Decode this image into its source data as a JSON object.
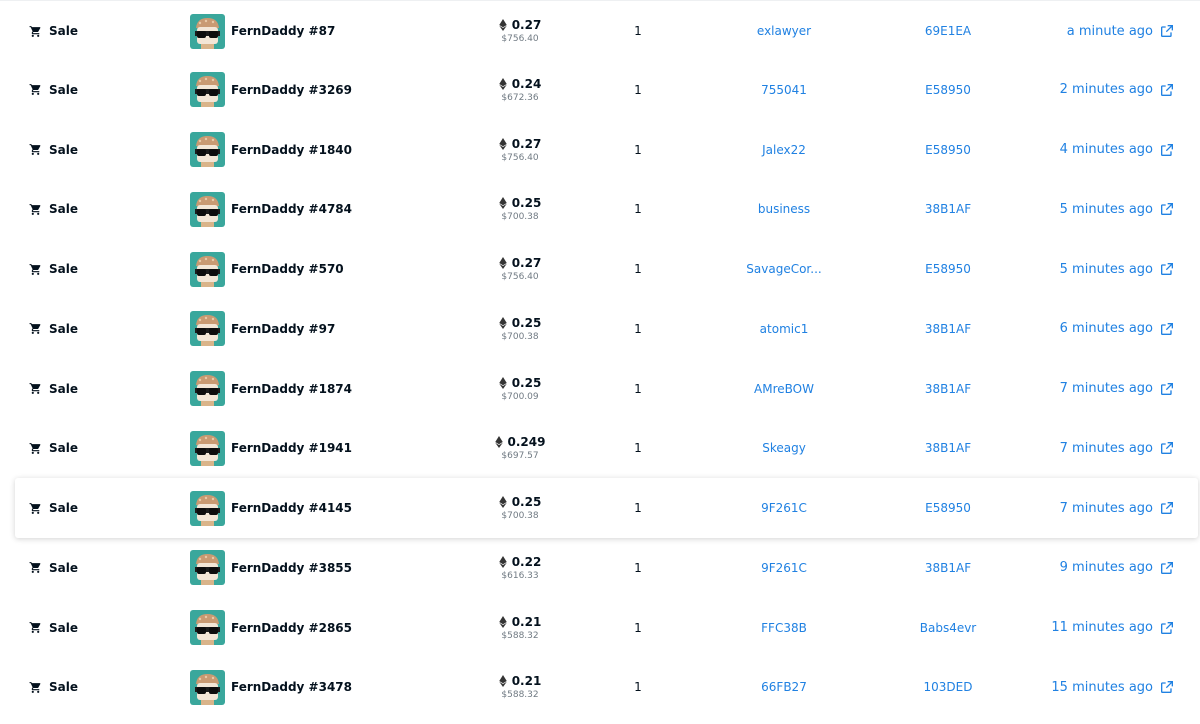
{
  "colors": {
    "link": "#2081e2",
    "text": "#04111d",
    "muted": "#707a83"
  },
  "icons": {
    "event": "cart-icon",
    "price": "eth-icon",
    "time": "external-link-icon"
  },
  "rows": [
    {
      "event": "Sale",
      "item": "FernDaddy #87",
      "price_eth": "0.27",
      "price_usd": "$756.40",
      "quantity": "1",
      "from": "exlawyer",
      "to": "69E1EA",
      "time": "a minute ago",
      "highlighted": false
    },
    {
      "event": "Sale",
      "item": "FernDaddy #3269",
      "price_eth": "0.24",
      "price_usd": "$672.36",
      "quantity": "1",
      "from": "755041",
      "to": "E58950",
      "time": "2 minutes ago",
      "highlighted": false
    },
    {
      "event": "Sale",
      "item": "FernDaddy #1840",
      "price_eth": "0.27",
      "price_usd": "$756.40",
      "quantity": "1",
      "from": "Jalex22",
      "to": "E58950",
      "time": "4 minutes ago",
      "highlighted": false
    },
    {
      "event": "Sale",
      "item": "FernDaddy #4784",
      "price_eth": "0.25",
      "price_usd": "$700.38",
      "quantity": "1",
      "from": "business",
      "to": "38B1AF",
      "time": "5 minutes ago",
      "highlighted": false
    },
    {
      "event": "Sale",
      "item": "FernDaddy #570",
      "price_eth": "0.27",
      "price_usd": "$756.40",
      "quantity": "1",
      "from": "SavageCor...",
      "to": "E58950",
      "time": "5 minutes ago",
      "highlighted": false
    },
    {
      "event": "Sale",
      "item": "FernDaddy #97",
      "price_eth": "0.25",
      "price_usd": "$700.38",
      "quantity": "1",
      "from": "atomic1",
      "to": "38B1AF",
      "time": "6 minutes ago",
      "highlighted": false
    },
    {
      "event": "Sale",
      "item": "FernDaddy #1874",
      "price_eth": "0.25",
      "price_usd": "$700.09",
      "quantity": "1",
      "from": "AMreBOW",
      "to": "38B1AF",
      "time": "7 minutes ago",
      "highlighted": false
    },
    {
      "event": "Sale",
      "item": "FernDaddy #1941",
      "price_eth": "0.249",
      "price_usd": "$697.57",
      "quantity": "1",
      "from": "Skeagy",
      "to": "38B1AF",
      "time": "7 minutes ago",
      "highlighted": false
    },
    {
      "event": "Sale",
      "item": "FernDaddy #4145",
      "price_eth": "0.25",
      "price_usd": "$700.38",
      "quantity": "1",
      "from": "9F261C",
      "to": "E58950",
      "time": "7 minutes ago",
      "highlighted": true
    },
    {
      "event": "Sale",
      "item": "FernDaddy #3855",
      "price_eth": "0.22",
      "price_usd": "$616.33",
      "quantity": "1",
      "from": "9F261C",
      "to": "38B1AF",
      "time": "9 minutes ago",
      "highlighted": false
    },
    {
      "event": "Sale",
      "item": "FernDaddy #2865",
      "price_eth": "0.21",
      "price_usd": "$588.32",
      "quantity": "1",
      "from": "FFC38B",
      "to": "Babs4evr",
      "time": "11 minutes ago",
      "highlighted": false
    },
    {
      "event": "Sale",
      "item": "FernDaddy #3478",
      "price_eth": "0.21",
      "price_usd": "$588.32",
      "quantity": "1",
      "from": "66FB27",
      "to": "103DED",
      "time": "15 minutes ago",
      "highlighted": false
    }
  ]
}
